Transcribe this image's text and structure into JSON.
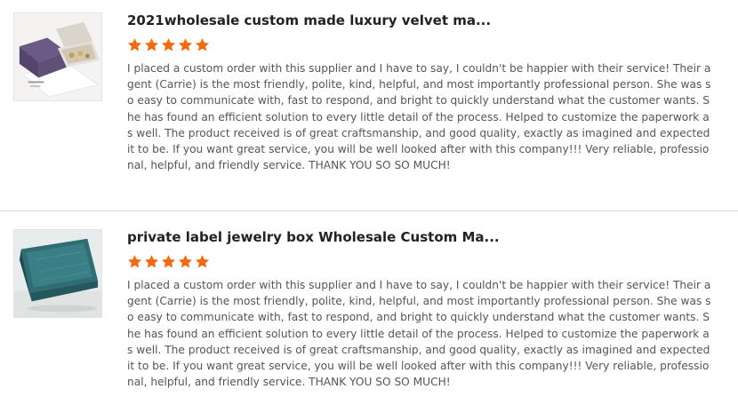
{
  "reviews": [
    {
      "title": "2021wholesale custom made luxury velvet ma...",
      "rating": 5,
      "star_color": "#f26a10",
      "image_icon": "velvet-jewelry-box-photo",
      "text": "I placed a custom order with this supplier and I have to say, I couldn't be happier with their service! Their agent (Carrie) is the most friendly, polite, kind, helpful, and most importantly professional person. She was so easy to communicate with, fast to respond, and bright to quickly understand what the customer wants. She has found an efficient solution to every little detail of the process. Helped to customize the paperwork as well. The product received is of great craftsmanship, and good quality, exactly as imagined and expected it to be. If you want great service, you will be well looked after with this company!!! Very reliable, professional, helpful, and friendly service. THANK YOU SO SO MUCH!"
    },
    {
      "title": "private label jewelry box Wholesale Custom Ma...",
      "rating": 5,
      "star_color": "#f26a10",
      "image_icon": "teal-jewelry-box-photo",
      "text": "I placed a custom order with this supplier and I have to say, I couldn't be happier with their service! Their agent (Carrie) is the most friendly, polite, kind, helpful, and most importantly professional person. She was so easy to communicate with, fast to respond, and bright to quickly understand what the customer wants. She has found an efficient solution to every little detail of the process. Helped to customize the paperwork as well. The product received is of great craftsmanship, and good quality, exactly as imagined and expected it to be. If you want great service, you will be well looked after with this company!!! Very reliable, professional, helpful, and friendly service. THANK YOU SO SO MUCH!"
    }
  ]
}
